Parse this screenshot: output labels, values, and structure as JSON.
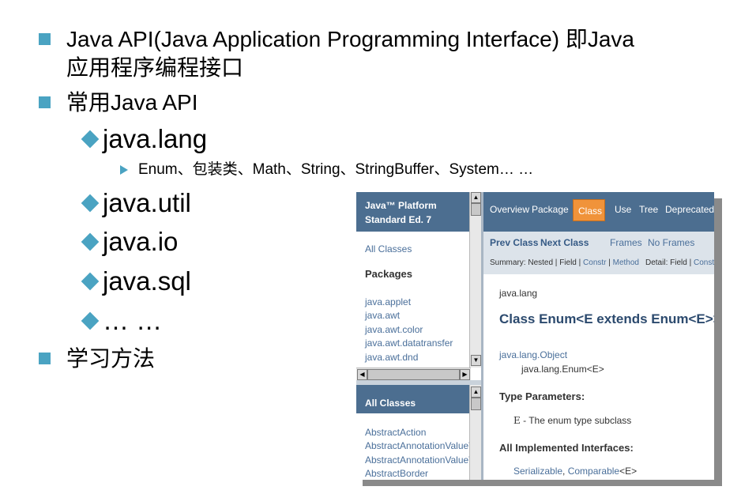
{
  "slide": {
    "bullet1_line1": "Java API(Java Application Programming Interface) 即Java",
    "bullet1_line2": "应用程序编程接口",
    "bullet2": "常用Java API",
    "sub1": "java.lang",
    "sub1_detail": "Enum、包装类、Math、String、StringBuffer、System… …",
    "sub2": "java.util",
    "sub3": "java.io",
    "sub4": "java.sql",
    "sub5": "… …",
    "bullet3": "学习方法",
    "accent_color": "#4aa3c2"
  },
  "javadoc": {
    "left_header_line1": "Java™ Platform",
    "left_header_line2": "Standard Ed. 7",
    "all_classes_link": "All Classes",
    "packages_label": "Packages",
    "packages": [
      "java.applet",
      "java.awt",
      "java.awt.color",
      "java.awt.datatransfer",
      "java.awt.dnd"
    ],
    "all_classes_header": "All Classes",
    "classes": [
      "AbstractAction",
      "AbstractAnnotationValueVis",
      "AbstractAnnotationValueVis",
      "AbstractBorder"
    ],
    "nav": [
      "Overview",
      "Package",
      "Class",
      "Use",
      "Tree",
      "Deprecated"
    ],
    "nav_active": "Class",
    "prev_class": "Prev Class",
    "next_class": "Next Class",
    "frames": "Frames",
    "no_frames": "No Frames",
    "summary_label": "Summary:",
    "summary_nested": "Nested",
    "summary_field": "Field",
    "summary_constr": "Constr",
    "summary_method": "Method",
    "detail_label": "Detail:",
    "detail_field": "Field",
    "detail_constr": "Constr",
    "package_name": "java.lang",
    "class_title": "Class Enum<E extends Enum<E>>",
    "hierarchy_parent": "java.lang.Object",
    "hierarchy_child": "java.lang.Enum<E>",
    "type_params_label": "Type Parameters:",
    "type_param_E": "E",
    "type_param_desc": " - The enum type subclass",
    "interfaces_label": "All Implemented Interfaces:",
    "iface_serializable": "Serializable",
    "iface_sep": ", ",
    "iface_comparable": "Comparable",
    "iface_generic": "<E>",
    "header_color": "#4c6e90",
    "active_tab_color": "#f0933a"
  }
}
